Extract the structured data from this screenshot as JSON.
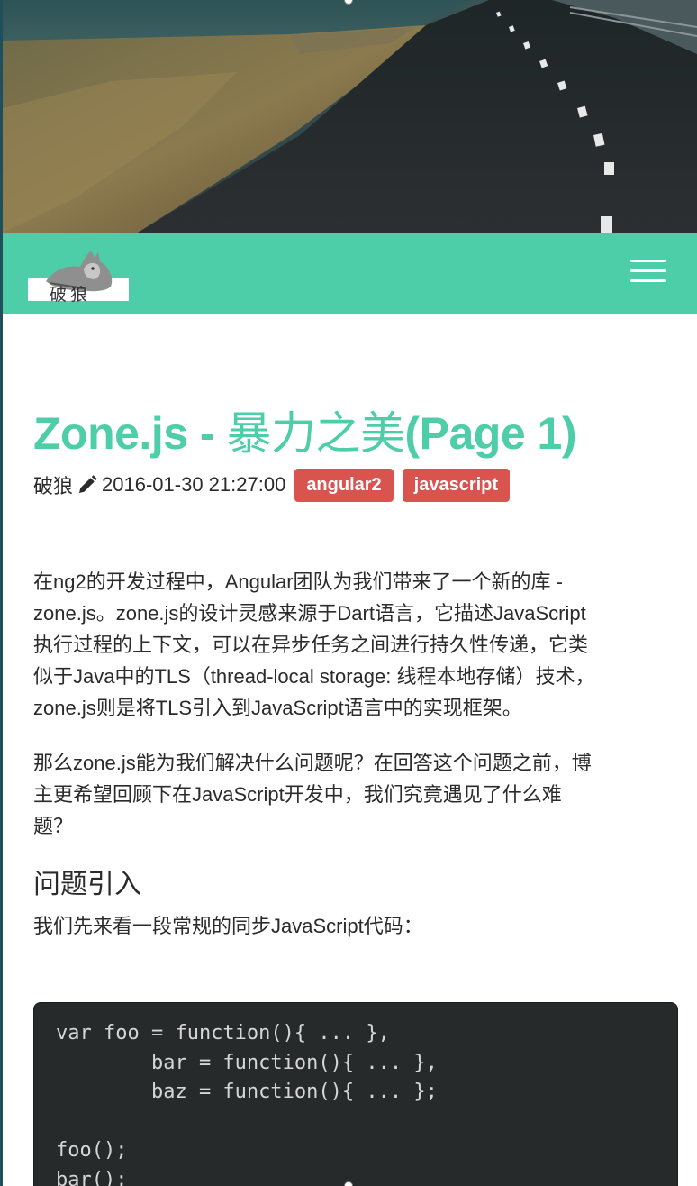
{
  "navbar": {
    "logo_text": "破狼",
    "menu_icon": "hamburger-menu-icon",
    "background_color": "#4ecda9"
  },
  "post": {
    "title_part1": "Zone.js - ",
    "title_part2": "暴力之美",
    "title_part3": "(Page 1)",
    "author": "破狼",
    "datetime": "2016-01-30 21:27:00",
    "tags": [
      "angular2",
      "javascript"
    ],
    "tag_color": "#d9534f",
    "paragraph1_lines": [
      "在ng2的开发过程中，Angular团队为我们带来了一个新的库 -",
      "zone.js。zone.js的设计灵感来源于Dart语言，它描述JavaScript",
      "执行过程的上下文，可以在异步任务之间进行持久性传递，它类",
      "似于Java中的TLS（thread-local storage: 线程本地存储）技术，",
      "zone.js则是将TLS引入到JavaScript语言中的实现框架。"
    ],
    "paragraph2_lines": [
      "那么zone.js能为我们解决什么问题呢？在回答这个问题之前，博",
      "主更希望回顾下在JavaScript开发中，我们究竟遇见了什么难",
      "题？"
    ],
    "section_heading": "问题引入",
    "paragraph3": "我们先来看一段常规的同步JavaScript代码：",
    "code": "var foo = function(){ ... },\n        bar = function(){ ... },\n        baz = function(){ ... };\n\nfoo();\nbar();"
  }
}
